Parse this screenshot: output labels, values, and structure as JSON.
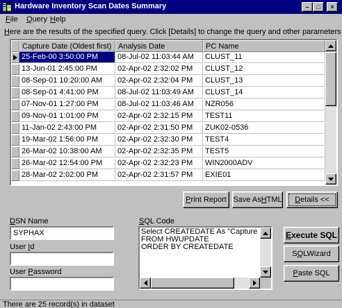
{
  "window": {
    "title": "Hardware Inventory Scan Dates Summary",
    "minimize_glyph": "–",
    "maximize_glyph": "□",
    "close_glyph": "✕"
  },
  "menu": {
    "items": [
      {
        "label_ul": "F",
        "label_rest": "ile"
      },
      {
        "label_ul": "Q",
        "label_rest": "uery"
      },
      {
        "label_ul": "H",
        "label_rest": "elp"
      }
    ]
  },
  "instructions": {
    "ul": "H",
    "rest": "ere are the results of the specified query. Click [Details] to change the query and other parameters"
  },
  "grid": {
    "columns": [
      "Capture Date (Oldest first)",
      "Analysis Date",
      "PC Name"
    ],
    "rows": [
      [
        "25-Feb-00 3:50:00 PM",
        "08-Jul-02 11:03:44 AM",
        "CLUST_11"
      ],
      [
        "13-Jun-01 2:45:00 PM",
        "02-Apr-02 2:32:02 PM",
        "CLUST_12"
      ],
      [
        "08-Sep-01 10:20:00 AM",
        "02-Apr-02 2:32:04 PM",
        "CLUST_13"
      ],
      [
        "08-Sep-01 4:41:00 PM",
        "08-Jul-02 11:03:49 AM",
        "CLUST_14"
      ],
      [
        "07-Nov-01 1:27:00 PM",
        "08-Jul-02 11:03:46 AM",
        "NZR056"
      ],
      [
        "09-Nov-01 1:01:00 PM",
        "02-Apr-02 2:32:15 PM",
        "TEST11"
      ],
      [
        "11-Jan-02 2:43:00 PM",
        "02-Apr-02 2:31:50 PM",
        "ZUK02-0536"
      ],
      [
        "19-Mar-02 1:56:00 PM",
        "02-Apr-02 2:32:30 PM",
        "TEST4"
      ],
      [
        "26-Mar-02 10:38:00 AM",
        "02-Apr-02 2:32:35 PM",
        "TEST5"
      ],
      [
        "26-Mar-02 12:54:00 PM",
        "02-Apr-02 2:32:23 PM",
        "WIN2000ADV"
      ],
      [
        "28-Mar-02 2:02:00 PM",
        "02-Apr-02 2:31:57 PM",
        "EXIE01"
      ]
    ]
  },
  "buttons": {
    "print_report": {
      "pre": "",
      "ul": "P",
      "post": "rint Report"
    },
    "save_as_html": {
      "pre": "Save As ",
      "ul": "H",
      "post": "TML"
    },
    "details": {
      "pre": "",
      "ul": "D",
      "post": "etails <<"
    },
    "execute_sql": {
      "pre": "",
      "ul": "E",
      "post": "xecute SQL"
    },
    "sql_wizard": {
      "pre": "S",
      "ul": "Q",
      "post": "LWizard"
    },
    "paste_sql": {
      "pre": "",
      "ul": "P",
      "post": "aste SQL"
    }
  },
  "dsn": {
    "label_ul": "D",
    "label_rest": "SN Name",
    "value": "SYPHAX"
  },
  "user_id": {
    "label_pre": "User ",
    "label_ul": "I",
    "label_rest": "d",
    "value": ""
  },
  "user_password": {
    "label_pre": "User ",
    "label_ul": "P",
    "label_rest": "assword",
    "value": ""
  },
  "sql": {
    "label_ul": "S",
    "label_rest": "QL Code",
    "text": "Select CREATEDATE As \"Capture Date (Ol\nFROM HWUPDATE\nORDER BY CREATEDATE"
  },
  "status": {
    "text": "There are 25 record(s) in dataset"
  }
}
